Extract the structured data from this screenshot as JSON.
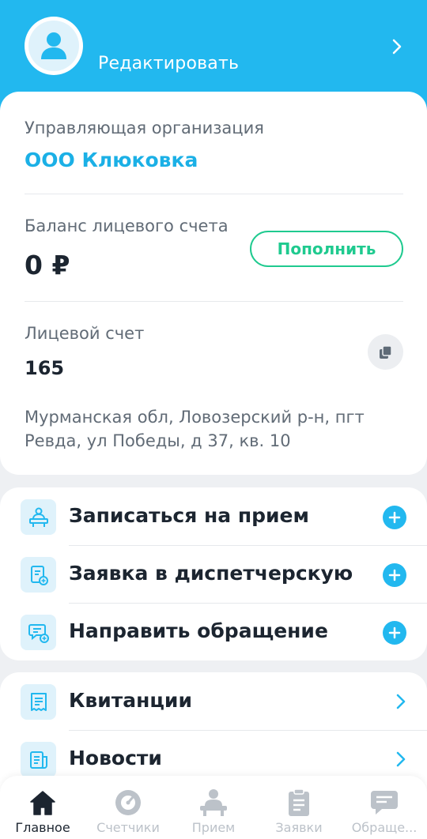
{
  "header": {
    "edit_label": "Редактировать",
    "accent_color": "#22b8ef",
    "avatar_icon": "user-avatar-icon",
    "chevron_icon": "chevron-right-icon"
  },
  "account": {
    "org_label": "Управляющая организация",
    "org_name": "ООО Клюковка",
    "balance_label": "Баланс лицевого счета",
    "balance_value": "0 ₽",
    "topup_label": "Пополнить",
    "account_label": "Лицевой счет",
    "account_number": "165",
    "copy_icon": "copy-icon",
    "address": "Мурманская обл, Ловозерский р-н, пгт Ревда, ул Победы, д 37, кв. 10"
  },
  "actions": [
    {
      "label": "Записаться на прием",
      "icon": "reception-desk-icon"
    },
    {
      "label": "Заявка в диспетчерскую",
      "icon": "request-form-icon"
    },
    {
      "label": "Направить обращение",
      "icon": "appeal-message-icon"
    }
  ],
  "links": [
    {
      "label": "Квитанции",
      "icon": "receipt-icon"
    },
    {
      "label": "Новости",
      "icon": "news-icon"
    }
  ],
  "nav": {
    "items": [
      {
        "label": "Главное",
        "icon": "home-icon",
        "active": true
      },
      {
        "label": "Счетчики",
        "icon": "meter-icon",
        "active": false
      },
      {
        "label": "Прием",
        "icon": "reception-icon",
        "active": false
      },
      {
        "label": "Заявки",
        "icon": "requests-icon",
        "active": false
      },
      {
        "label": "Обраще...",
        "icon": "chat-icon",
        "active": false
      }
    ]
  },
  "colors": {
    "primary": "#22b8ef",
    "success": "#1fca8f",
    "text": "#1c2530",
    "muted": "#616b76",
    "inactive": "#bcc2c9"
  }
}
